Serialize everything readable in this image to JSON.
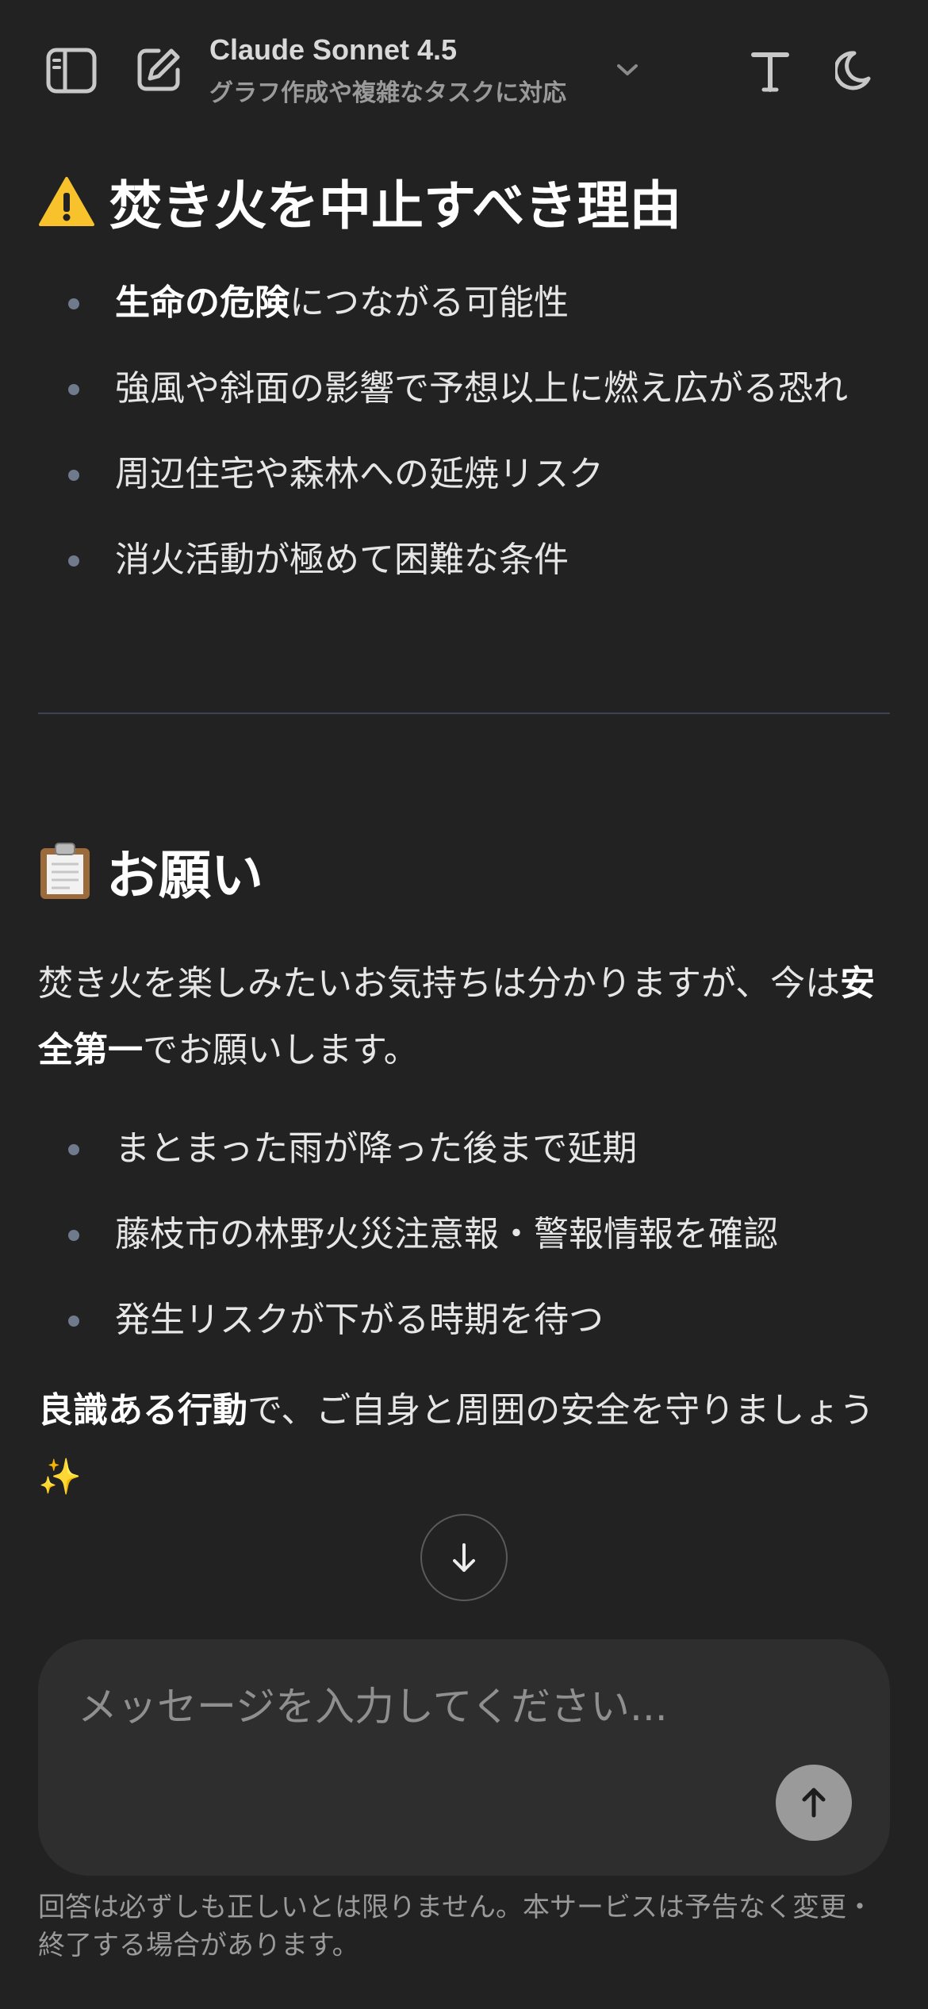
{
  "header": {
    "model_name": "Claude Sonnet 4.5",
    "model_subtitle": "グラフ作成や複雑なタスクに対応",
    "icons": [
      "sidebar-icon",
      "new-chat-icon",
      "chevron-down-icon",
      "font-size-icon",
      "dark-mode-icon"
    ]
  },
  "section1": {
    "emoji": "⚠️",
    "title": "焚き火を中止すべき理由",
    "items": [
      {
        "bold": "生命の危険",
        "text": "につながる可能性"
      },
      {
        "bold": "",
        "text": "強風や斜面の影響で予想以上に燃え広がる恐れ"
      },
      {
        "bold": "",
        "text": "周辺住宅や森林への延焼リスク"
      },
      {
        "bold": "",
        "text": "消火活動が極めて困難な条件"
      }
    ]
  },
  "section2": {
    "emoji": "📋",
    "title": "お願い",
    "intro_before": "焚き火を楽しみたいお気持ちは分かりますが、今は",
    "intro_bold": "安全第一",
    "intro_after": "でお願いします。",
    "items": [
      "まとまった雨が降った後まで延期",
      "藤枝市の林野火災注意報・警報情報を確認",
      "発生リスクが下がる時期を待つ"
    ],
    "closing_bold": "良識ある行動",
    "closing_text": "で、ご自身と周囲の安全を守りましょう✨"
  },
  "composer": {
    "placeholder": "メッセージを入力してください..."
  },
  "disclaimer": "回答は必ずしも正しいとは限りません。本サービスは予告なく変更・終了する場合があります。"
}
